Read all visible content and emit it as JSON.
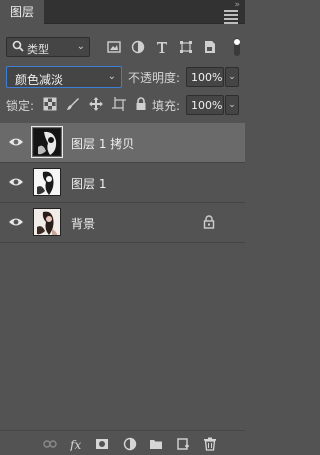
{
  "panel": {
    "tab_label": "图层"
  },
  "filter": {
    "kind_label": "类型"
  },
  "blend": {
    "mode": "颜色减淡"
  },
  "opacity": {
    "label": "不透明度:",
    "value": "100%"
  },
  "lock": {
    "label": "锁定:"
  },
  "fill": {
    "label": "填充:",
    "value": "100%"
  },
  "layers": [
    {
      "name": "图层 1 拷贝",
      "selected": true
    },
    {
      "name": "图层 1",
      "selected": false
    },
    {
      "name": "背景",
      "selected": false,
      "locked": true
    }
  ],
  "colors": {
    "panel_bg": "#535353",
    "selected_row": "#6a6a6a",
    "focus_border": "#3d7fd6"
  }
}
